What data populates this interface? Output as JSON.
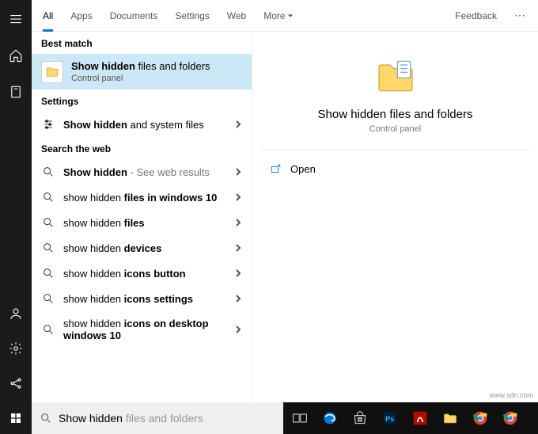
{
  "tabs": {
    "all": "All",
    "apps": "Apps",
    "documents": "Documents",
    "settings": "Settings",
    "web": "Web",
    "more": "More",
    "feedback": "Feedback"
  },
  "sections": {
    "best": "Best match",
    "settings": "Settings",
    "web": "Search the web"
  },
  "best_match": {
    "title_bold": "Show hidden",
    "title_rest": " files and folders",
    "subtitle": "Control panel"
  },
  "settings_items": [
    {
      "bold": "Show hidden",
      "rest": " and system files"
    }
  ],
  "web_items": [
    {
      "pre": "",
      "bold": "Show hidden",
      "post": "",
      "extra": " - See web results"
    },
    {
      "pre": "show hidden ",
      "bold": "files in windows 10",
      "post": ""
    },
    {
      "pre": "show hidden ",
      "bold": "files",
      "post": ""
    },
    {
      "pre": "show hidden ",
      "bold": "devices",
      "post": ""
    },
    {
      "pre": "show hidden ",
      "bold": "icons button",
      "post": ""
    },
    {
      "pre": "show hidden ",
      "bold": "icons settings",
      "post": ""
    },
    {
      "pre": "show hidden ",
      "bold": "icons on desktop windows 10",
      "post": ""
    }
  ],
  "preview": {
    "title": "Show hidden files and folders",
    "subtitle": "Control panel",
    "open": "Open"
  },
  "search": {
    "typed": "Show hidden",
    "ghost": " files and folders"
  },
  "watermark": "www.sdn.com"
}
